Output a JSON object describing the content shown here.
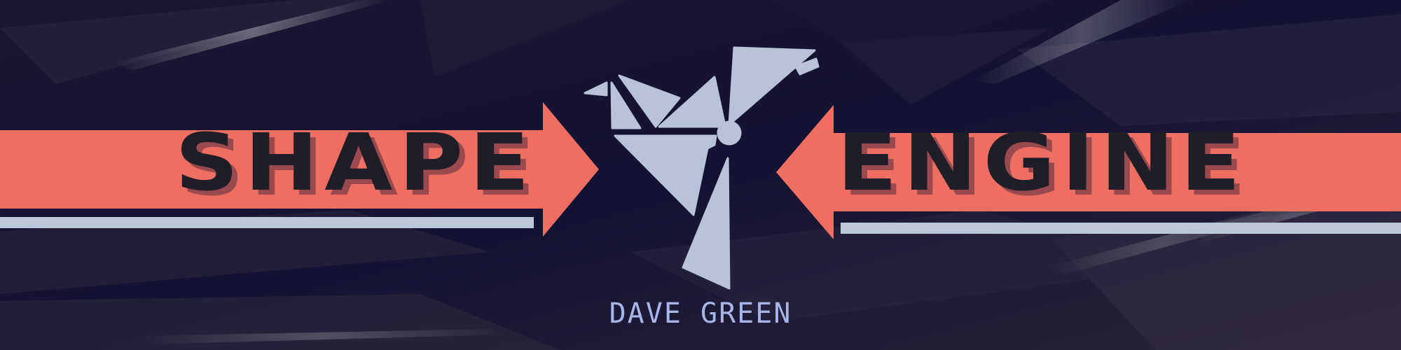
{
  "banner": {
    "title_left": "SHAPE",
    "title_right": "ENGINE",
    "author": "DAVE GREEN"
  },
  "logo": {
    "icon": "origami-bird-icon"
  },
  "colors": {
    "background": "#15112a",
    "band": "#ee6f62",
    "stripe": "#bcc6d9",
    "logo": "#b9c3d8",
    "title_text": "#1f1d28",
    "title_shadow": "#9a4a4e",
    "author_text": "#a7b6e8"
  }
}
